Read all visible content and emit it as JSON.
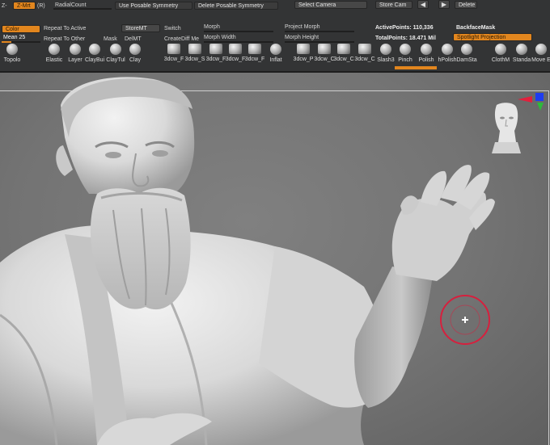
{
  "shelf": {
    "row1": {
      "zadd_label": "Z-",
      "zsub_label": "Z-Mrt",
      "rgb_label": "(R)",
      "radial_count": "RadialCount",
      "use_posable_symmetry": "Use Posable Symmetry",
      "delete_posable_symmetry": "Delete Posable Symmetry",
      "select_camera": "Select Camera",
      "store_cam": "Store Cam",
      "prev_arrow": "◀",
      "next_arrow": "▶",
      "delete": "Delete"
    },
    "row2": {
      "color": "Color",
      "repeat_to_active": "Repeat To Active",
      "store_mt": "StoreMT",
      "switch": "Switch",
      "morph": "Morph",
      "project_morph": "Project Morph",
      "active_points": "ActivePoints: 110,336",
      "backface_mask": "BackfaceMask"
    },
    "row3": {
      "mean_label": "Mean 25",
      "mean_value": 0.25,
      "repeat_to_other": "Repeat To Other",
      "mask": "Mask",
      "del_mt": "DelMT",
      "create_diff_mesh": "CreateDiff Me",
      "morph_width": "Morph Width",
      "morph_height": "Morph Height",
      "total_points": "TotalPoints: 18.471 Mil",
      "spotlight_projection": "Spotlight Projection"
    },
    "brushes": [
      {
        "name": "Topolo",
        "icon": "topology-brush-icon"
      },
      {
        "name": "Elastic",
        "icon": "elastic-brush-icon"
      },
      {
        "name": "Layer",
        "icon": "layer-brush-icon"
      },
      {
        "name": "ClayBui",
        "icon": "claybuildup-brush-icon"
      },
      {
        "name": "ClayTul",
        "icon": "claytubes-brush-icon"
      },
      {
        "name": "Clay",
        "icon": "clay-brush-icon"
      },
      {
        "name": "3dcw_F",
        "icon": "fabric-brush-icon"
      },
      {
        "name": "3dcw_S",
        "icon": "fabric-brush-icon"
      },
      {
        "name": "3dcw_F",
        "icon": "fabric-brush-icon"
      },
      {
        "name": "3dcw_F",
        "icon": "fabric-brush-icon"
      },
      {
        "name": "3dcw_F",
        "icon": "fabric-brush-icon"
      },
      {
        "name": "Inflat",
        "icon": "inflate-brush-icon"
      },
      {
        "name": "3dcw_P",
        "icon": "fabric-brush-icon"
      },
      {
        "name": "3dcw_C",
        "icon": "fabric-brush-icon"
      },
      {
        "name": "3dcw_C",
        "icon": "fabric-brush-icon"
      },
      {
        "name": "3dcw_C",
        "icon": "fabric-brush-icon"
      },
      {
        "name": "Slash3",
        "icon": "slash-brush-icon"
      },
      {
        "name": "Pinch",
        "icon": "pinch-brush-icon"
      },
      {
        "name": "Polish",
        "icon": "polish-brush-icon"
      },
      {
        "name": "hPolish",
        "icon": "hpolish-brush-icon"
      },
      {
        "name": "DamSta",
        "icon": "damstandard-brush-icon"
      },
      {
        "name": "ClothM",
        "icon": "cloth-brush-icon"
      },
      {
        "name": "Standa",
        "icon": "standard-brush-icon"
      },
      {
        "name": "Move E",
        "icon": "move-brush-icon"
      }
    ]
  },
  "colors": {
    "accent": "#e2861e",
    "shelf_bg": "#333435",
    "viewport_bg": "#777777",
    "cursor": "#d6203e"
  }
}
